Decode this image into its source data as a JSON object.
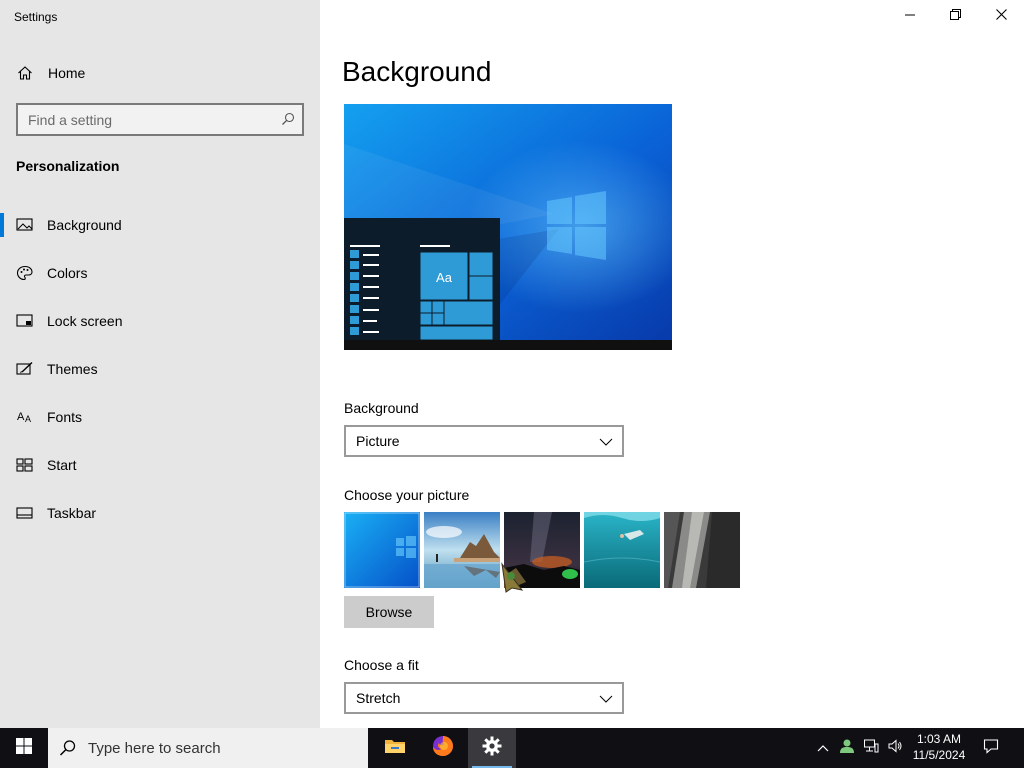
{
  "window": {
    "title": "Settings",
    "controls": [
      "minimize",
      "restore",
      "close"
    ]
  },
  "sidebar": {
    "home_label": "Home",
    "search_placeholder": "Find a setting",
    "section_title": "Personalization",
    "items": [
      {
        "label": "Background",
        "icon": "picture-icon",
        "active": true
      },
      {
        "label": "Colors",
        "icon": "palette-icon",
        "active": false
      },
      {
        "label": "Lock screen",
        "icon": "lock-screen-icon",
        "active": false
      },
      {
        "label": "Themes",
        "icon": "themes-icon",
        "active": false
      },
      {
        "label": "Fonts",
        "icon": "fonts-icon",
        "active": false
      },
      {
        "label": "Start",
        "icon": "start-icon",
        "active": false
      },
      {
        "label": "Taskbar",
        "icon": "taskbar-icon",
        "active": false
      }
    ]
  },
  "main": {
    "page_title": "Background",
    "preview": {
      "tile_label": "Aa"
    },
    "background_label": "Background",
    "background_value": "Picture",
    "choose_picture_label": "Choose your picture",
    "pictures": [
      "windows-default",
      "beach-rocks",
      "night-sky",
      "underwater-swimmer",
      "rock-cliff"
    ],
    "browse_label": "Browse",
    "fit_label": "Choose a fit",
    "fit_value": "Stretch"
  },
  "taskbar": {
    "search_text": "Type here to search",
    "apps": [
      "file-explorer",
      "firefox",
      "settings"
    ],
    "time": "1:03 AM",
    "date": "11/5/2024"
  },
  "colors": {
    "accent": "#0078d7",
    "sidebar_bg": "#e6e6e6",
    "taskbar_bg": "#101014"
  }
}
